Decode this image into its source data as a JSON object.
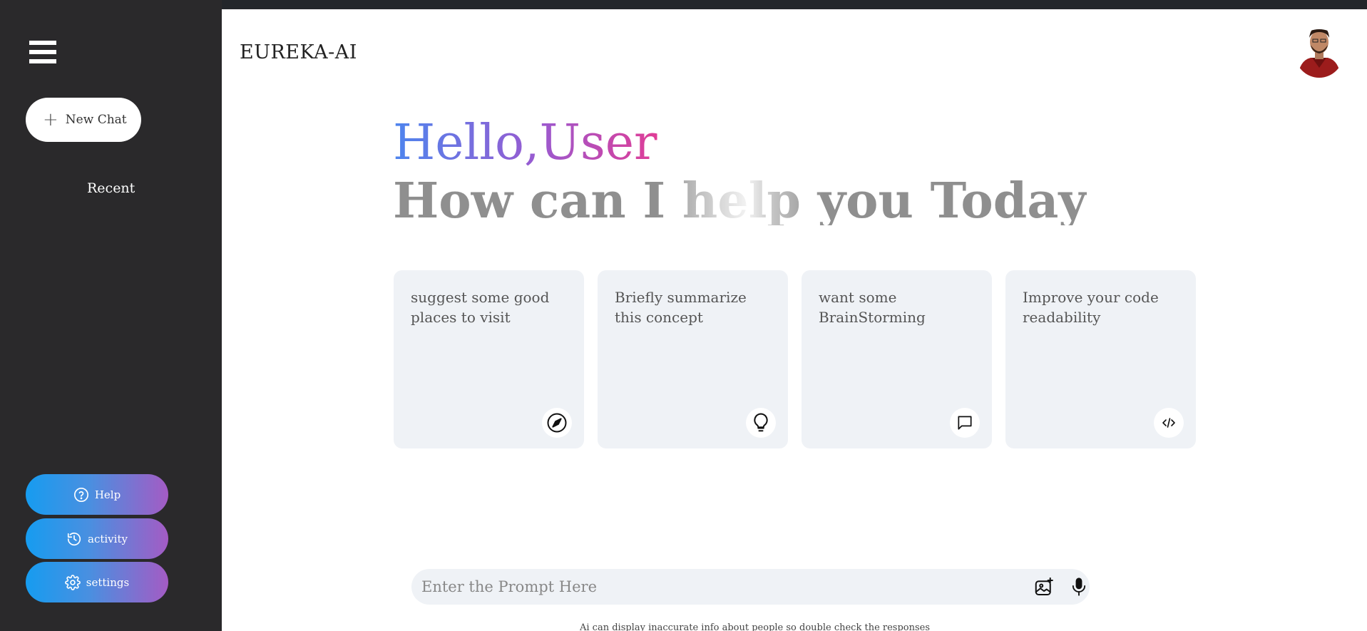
{
  "sidebar": {
    "menu_icon": "hamburger-menu-icon",
    "new_chat_label": "New Chat",
    "recent_label": "Recent",
    "buttons": [
      {
        "label": "Help",
        "icon": "help-circle-icon"
      },
      {
        "label": "activity",
        "icon": "history-icon"
      },
      {
        "label": "settings",
        "icon": "gear-icon"
      }
    ],
    "button_gradient": [
      "#169cf0",
      "#a45bc4"
    ]
  },
  "header": {
    "brand": "EUREKA-AI",
    "avatar": "user-avatar"
  },
  "greeting": {
    "hello": "Hello,User",
    "subtitle": "How can I help you Today"
  },
  "cards": [
    {
      "text": "suggest some good places to visit",
      "icon": "compass-icon"
    },
    {
      "text": "Briefly summarize this concept",
      "icon": "lightbulb-icon"
    },
    {
      "text": "want some BrainStorming",
      "icon": "message-icon"
    },
    {
      "text": "Improve your code readability",
      "icon": "code-icon"
    }
  ],
  "prompt": {
    "placeholder": "Enter the Prompt Here",
    "value": "",
    "icons": [
      "gallery-icon",
      "mic-icon"
    ]
  },
  "disclaimer": "Ai can display inaccurate info about people so double check the responses",
  "colors": {
    "sidebar_bg": "#2a292b",
    "card_bg": "#eff2f6",
    "greeting_gradient": [
      "#4d85ee",
      "#9a5ad0",
      "#e03d96"
    ]
  }
}
